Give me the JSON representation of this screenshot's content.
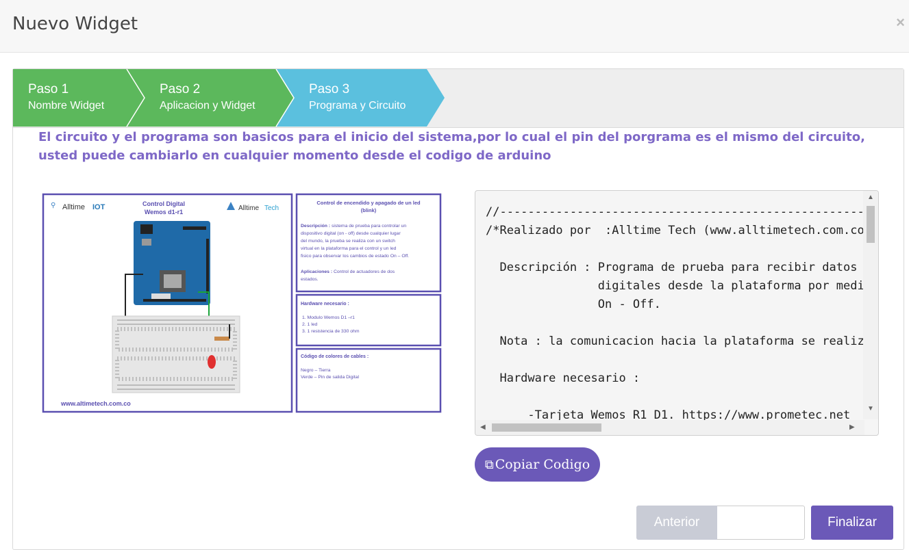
{
  "modal": {
    "title": "Nuevo Widget",
    "close": "×"
  },
  "steps": [
    {
      "title": "Paso 1",
      "subtitle": "Nombre Widget",
      "state": "done",
      "color": "#5cb85c"
    },
    {
      "title": "Paso 2",
      "subtitle": "Aplicacion y Widget",
      "state": "done",
      "color": "#5cb85c"
    },
    {
      "title": "Paso 3",
      "subtitle": "Programa y Circuito",
      "state": "current",
      "color": "#5bc0de"
    }
  ],
  "info_text": "El circuito y el programa son basicos para el inicio del sistema,por lo cual el pin del porgrama es el mismo del circuito, usted puede cambiarlo en cualquier momento desde el codigo de arduino",
  "circuit": {
    "brand_left": "Alltime",
    "brand_left_bold": "IOT",
    "title": "Control Digital\nWemos d1-r1",
    "brand_right": "Alltime",
    "brand_right_accent": "Tech",
    "website": "www.altimetech.com.co",
    "desc_title": "Control de encendido y apagado de  un led (blink)",
    "desc_label": "Descripción :",
    "desc_body": "sistema de prueba  para controlar un dispositivo digital (on - off) desde cualquier lugar del mundo, la prueba se realiza con un switch virtual en la plataforma para el control y un led fisico para observar los cambios de estado On – Off.",
    "apps_label": "Aplicaciones :",
    "apps_body": "Control de actuadores de dos estados.",
    "hw_title": "Hardware necesario :",
    "hw_items": [
      "1.     Modulo Wemos D1 –r1",
      "2.     1 led",
      "3.     1 resistencia de 330 ohm"
    ],
    "colors_title": "Código de colores de cables :",
    "colors_items": [
      "Negro – Tierra",
      "Verde – Pin de salida Digital"
    ]
  },
  "code_text": "//--------------------------------------------------------\n/*Realizado por  :Alltime Tech (www.alltimetech.com.co)\n\n  Descripción : Programa de prueba para recibir datos\n                digitales desde la plataforma por medio\n                On - Off.\n\n  Nota : la comunicacion hacia la plataforma se realiza\n\n  Hardware necesario :\n\n      -Tarjeta Wemos R1 D1. https://www.prometec.net",
  "buttons": {
    "copy": "Copiar Codigo",
    "copy_icon": "⧉",
    "previous": "Anterior",
    "finish": "Finalizar"
  }
}
